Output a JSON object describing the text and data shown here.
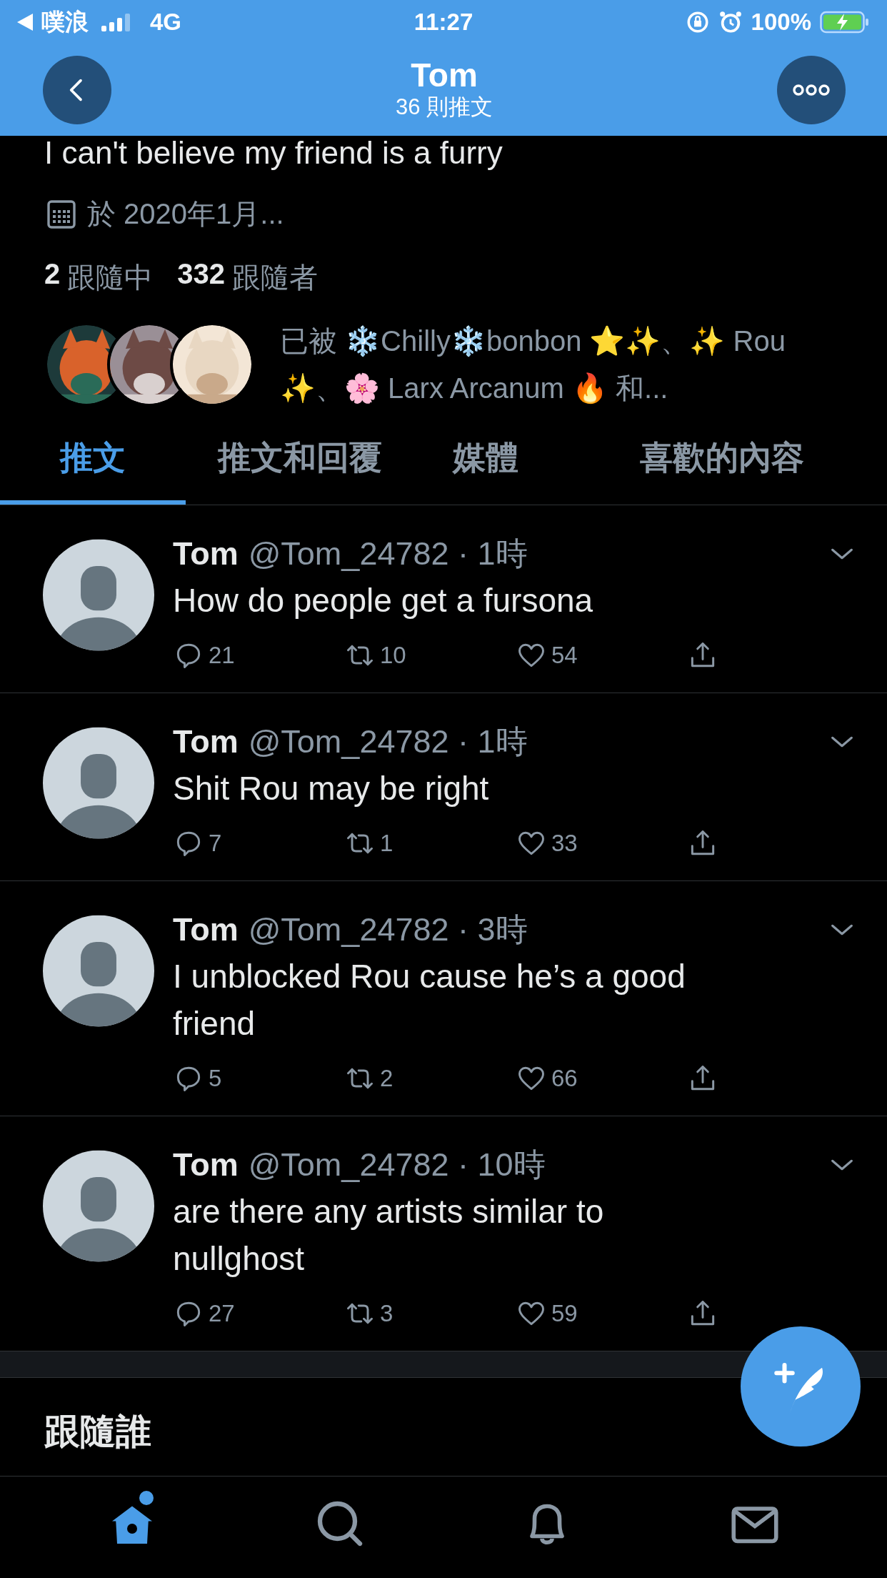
{
  "status_bar": {
    "back_app": "噗浪",
    "network": "4G",
    "time": "11:27",
    "battery": "100%"
  },
  "header": {
    "title": "Tom",
    "subtitle": "36 則推文"
  },
  "profile": {
    "bio": "I can't believe my friend is a furry",
    "joined": "於 2020年1月...",
    "following_count": "2",
    "following_label": "跟隨中",
    "followers_count": "332",
    "followers_label": "跟隨者",
    "followed_by": "已被 ❄️Chilly❄️bonbon ⭐️✨、✨ Rou ✨、🌸 Larx Arcanum 🔥 和..."
  },
  "tabs": [
    {
      "label": "推文",
      "selected": true
    },
    {
      "label": "推文和回覆",
      "selected": false
    },
    {
      "label": "媒體",
      "selected": false
    },
    {
      "label": "喜歡的內容",
      "selected": false
    }
  ],
  "tweets": [
    {
      "name": "Tom",
      "meta": "@Tom_24782 · 1時",
      "text": "How do people get a fursona",
      "replies": "21",
      "retweets": "10",
      "likes": "54"
    },
    {
      "name": "Tom",
      "meta": "@Tom_24782 · 1時",
      "text": "Shit Rou may be right",
      "replies": "7",
      "retweets": "1",
      "likes": "33"
    },
    {
      "name": "Tom",
      "meta": "@Tom_24782 · 3時",
      "text": "I unblocked Rou cause he’s a good friend",
      "replies": "5",
      "retweets": "2",
      "likes": "66"
    },
    {
      "name": "Tom",
      "meta": "@Tom_24782 · 10時",
      "text": "are there any artists similar to nullghost",
      "replies": "27",
      "retweets": "3",
      "likes": "59"
    }
  ],
  "who_to_follow": {
    "title": "跟隨誰"
  },
  "bottom_nav": [
    {
      "kind": "home",
      "selected": true,
      "dot": true
    },
    {
      "kind": "search",
      "selected": false,
      "dot": false
    },
    {
      "kind": "notifications",
      "selected": false,
      "dot": false
    },
    {
      "kind": "messages",
      "selected": false,
      "dot": false
    }
  ]
}
